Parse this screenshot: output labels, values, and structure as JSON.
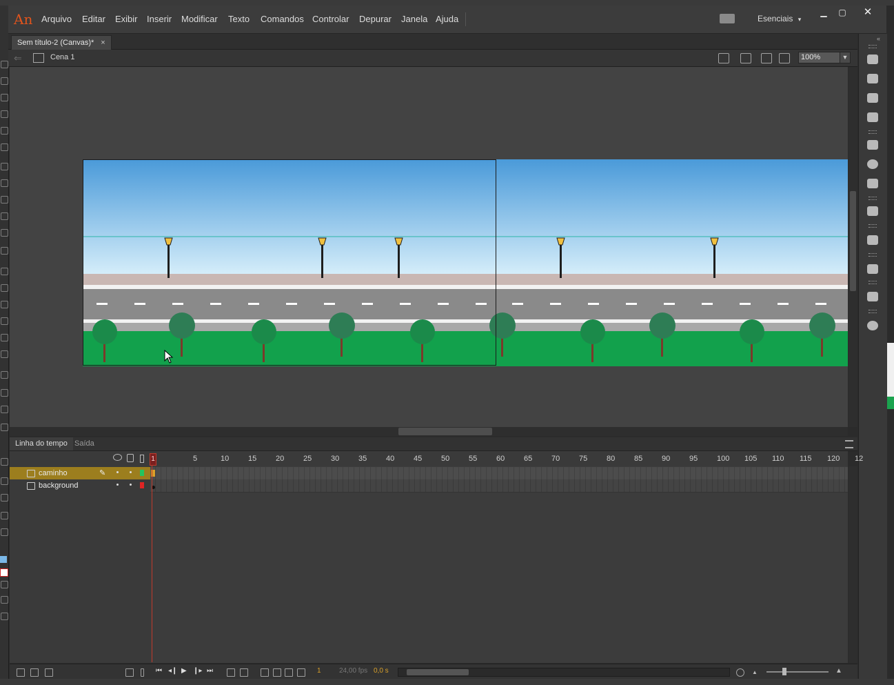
{
  "app": {
    "logo": "An"
  },
  "menu": {
    "items": [
      "Arquivo",
      "Editar",
      "Exibir",
      "Inserir",
      "Modificar",
      "Texto",
      "Comandos",
      "Controlar",
      "Depurar",
      "Janela",
      "Ajuda"
    ]
  },
  "workspace": {
    "label": "Esenciais",
    "caret": "▾"
  },
  "window_controls": {
    "minimize": "▁",
    "maximize": "▢",
    "close": "✕"
  },
  "document": {
    "tab_title": "Sem título-2 (Canvas)*",
    "close": "×"
  },
  "editbar": {
    "scene": "Cena 1",
    "zoom": "100%",
    "zoom_caret": "▼"
  },
  "timeline": {
    "tab_timeline": "Linha do tempo",
    "tab_output": "Saída",
    "playhead_frame": "1",
    "ruler": [
      "5",
      "10",
      "15",
      "20",
      "25",
      "30",
      "35",
      "40",
      "45",
      "50",
      "55",
      "60",
      "65",
      "70",
      "75",
      "80",
      "85",
      "90",
      "95",
      "100",
      "105",
      "110",
      "115",
      "120",
      "12"
    ],
    "layers": [
      {
        "name": "caminho",
        "color": "#22c55e",
        "selected": true
      },
      {
        "name": "background",
        "color": "#e02424",
        "selected": false
      }
    ],
    "status": {
      "frame": "1",
      "fps": "24,00 fps",
      "time": "0,0 s"
    }
  },
  "stage_colors": {
    "sky_top": "#4a9ad9",
    "sky_bottom": "#d6eefa",
    "road": "#8a8a8a",
    "grass": "#12a14c",
    "tree": "#1b8a4a"
  }
}
